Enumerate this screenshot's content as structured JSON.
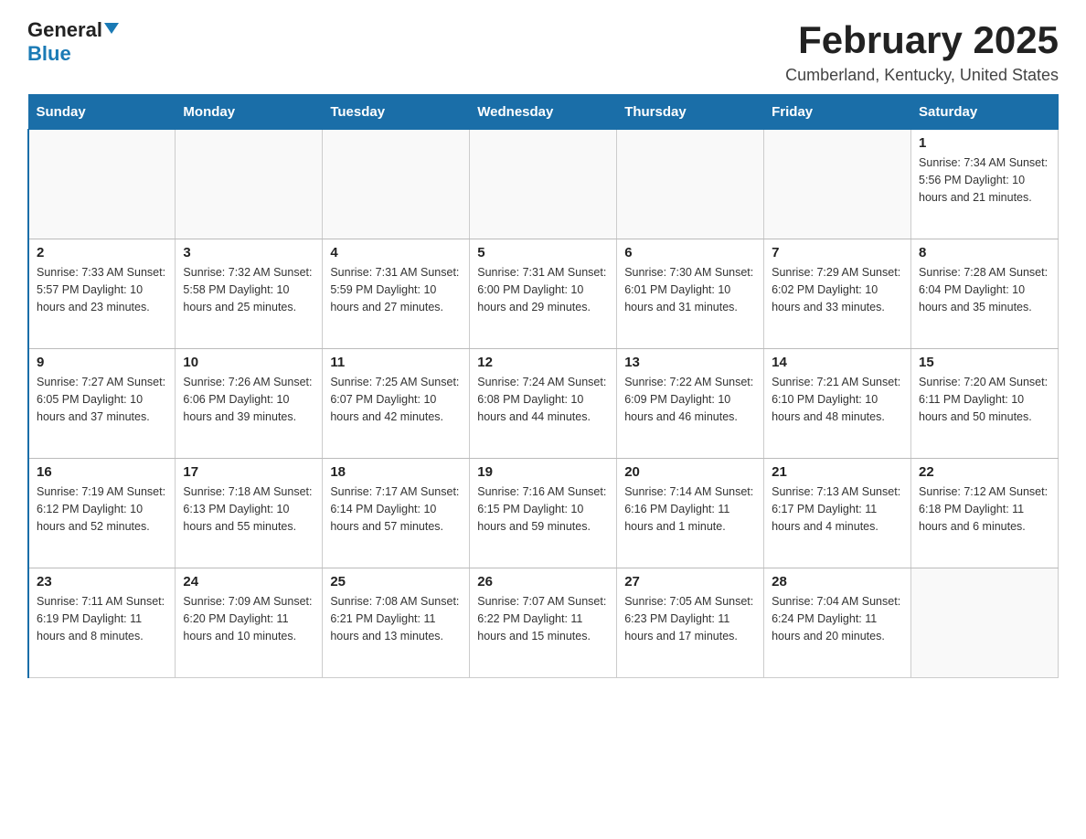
{
  "header": {
    "logo_general": "General",
    "logo_blue": "Blue",
    "title": "February 2025",
    "subtitle": "Cumberland, Kentucky, United States"
  },
  "days_of_week": [
    "Sunday",
    "Monday",
    "Tuesday",
    "Wednesday",
    "Thursday",
    "Friday",
    "Saturday"
  ],
  "weeks": [
    [
      {
        "day": "",
        "info": ""
      },
      {
        "day": "",
        "info": ""
      },
      {
        "day": "",
        "info": ""
      },
      {
        "day": "",
        "info": ""
      },
      {
        "day": "",
        "info": ""
      },
      {
        "day": "",
        "info": ""
      },
      {
        "day": "1",
        "info": "Sunrise: 7:34 AM\nSunset: 5:56 PM\nDaylight: 10 hours and 21 minutes."
      }
    ],
    [
      {
        "day": "2",
        "info": "Sunrise: 7:33 AM\nSunset: 5:57 PM\nDaylight: 10 hours and 23 minutes."
      },
      {
        "day": "3",
        "info": "Sunrise: 7:32 AM\nSunset: 5:58 PM\nDaylight: 10 hours and 25 minutes."
      },
      {
        "day": "4",
        "info": "Sunrise: 7:31 AM\nSunset: 5:59 PM\nDaylight: 10 hours and 27 minutes."
      },
      {
        "day": "5",
        "info": "Sunrise: 7:31 AM\nSunset: 6:00 PM\nDaylight: 10 hours and 29 minutes."
      },
      {
        "day": "6",
        "info": "Sunrise: 7:30 AM\nSunset: 6:01 PM\nDaylight: 10 hours and 31 minutes."
      },
      {
        "day": "7",
        "info": "Sunrise: 7:29 AM\nSunset: 6:02 PM\nDaylight: 10 hours and 33 minutes."
      },
      {
        "day": "8",
        "info": "Sunrise: 7:28 AM\nSunset: 6:04 PM\nDaylight: 10 hours and 35 minutes."
      }
    ],
    [
      {
        "day": "9",
        "info": "Sunrise: 7:27 AM\nSunset: 6:05 PM\nDaylight: 10 hours and 37 minutes."
      },
      {
        "day": "10",
        "info": "Sunrise: 7:26 AM\nSunset: 6:06 PM\nDaylight: 10 hours and 39 minutes."
      },
      {
        "day": "11",
        "info": "Sunrise: 7:25 AM\nSunset: 6:07 PM\nDaylight: 10 hours and 42 minutes."
      },
      {
        "day": "12",
        "info": "Sunrise: 7:24 AM\nSunset: 6:08 PM\nDaylight: 10 hours and 44 minutes."
      },
      {
        "day": "13",
        "info": "Sunrise: 7:22 AM\nSunset: 6:09 PM\nDaylight: 10 hours and 46 minutes."
      },
      {
        "day": "14",
        "info": "Sunrise: 7:21 AM\nSunset: 6:10 PM\nDaylight: 10 hours and 48 minutes."
      },
      {
        "day": "15",
        "info": "Sunrise: 7:20 AM\nSunset: 6:11 PM\nDaylight: 10 hours and 50 minutes."
      }
    ],
    [
      {
        "day": "16",
        "info": "Sunrise: 7:19 AM\nSunset: 6:12 PM\nDaylight: 10 hours and 52 minutes."
      },
      {
        "day": "17",
        "info": "Sunrise: 7:18 AM\nSunset: 6:13 PM\nDaylight: 10 hours and 55 minutes."
      },
      {
        "day": "18",
        "info": "Sunrise: 7:17 AM\nSunset: 6:14 PM\nDaylight: 10 hours and 57 minutes."
      },
      {
        "day": "19",
        "info": "Sunrise: 7:16 AM\nSunset: 6:15 PM\nDaylight: 10 hours and 59 minutes."
      },
      {
        "day": "20",
        "info": "Sunrise: 7:14 AM\nSunset: 6:16 PM\nDaylight: 11 hours and 1 minute."
      },
      {
        "day": "21",
        "info": "Sunrise: 7:13 AM\nSunset: 6:17 PM\nDaylight: 11 hours and 4 minutes."
      },
      {
        "day": "22",
        "info": "Sunrise: 7:12 AM\nSunset: 6:18 PM\nDaylight: 11 hours and 6 minutes."
      }
    ],
    [
      {
        "day": "23",
        "info": "Sunrise: 7:11 AM\nSunset: 6:19 PM\nDaylight: 11 hours and 8 minutes."
      },
      {
        "day": "24",
        "info": "Sunrise: 7:09 AM\nSunset: 6:20 PM\nDaylight: 11 hours and 10 minutes."
      },
      {
        "day": "25",
        "info": "Sunrise: 7:08 AM\nSunset: 6:21 PM\nDaylight: 11 hours and 13 minutes."
      },
      {
        "day": "26",
        "info": "Sunrise: 7:07 AM\nSunset: 6:22 PM\nDaylight: 11 hours and 15 minutes."
      },
      {
        "day": "27",
        "info": "Sunrise: 7:05 AM\nSunset: 6:23 PM\nDaylight: 11 hours and 17 minutes."
      },
      {
        "day": "28",
        "info": "Sunrise: 7:04 AM\nSunset: 6:24 PM\nDaylight: 11 hours and 20 minutes."
      },
      {
        "day": "",
        "info": ""
      }
    ]
  ]
}
